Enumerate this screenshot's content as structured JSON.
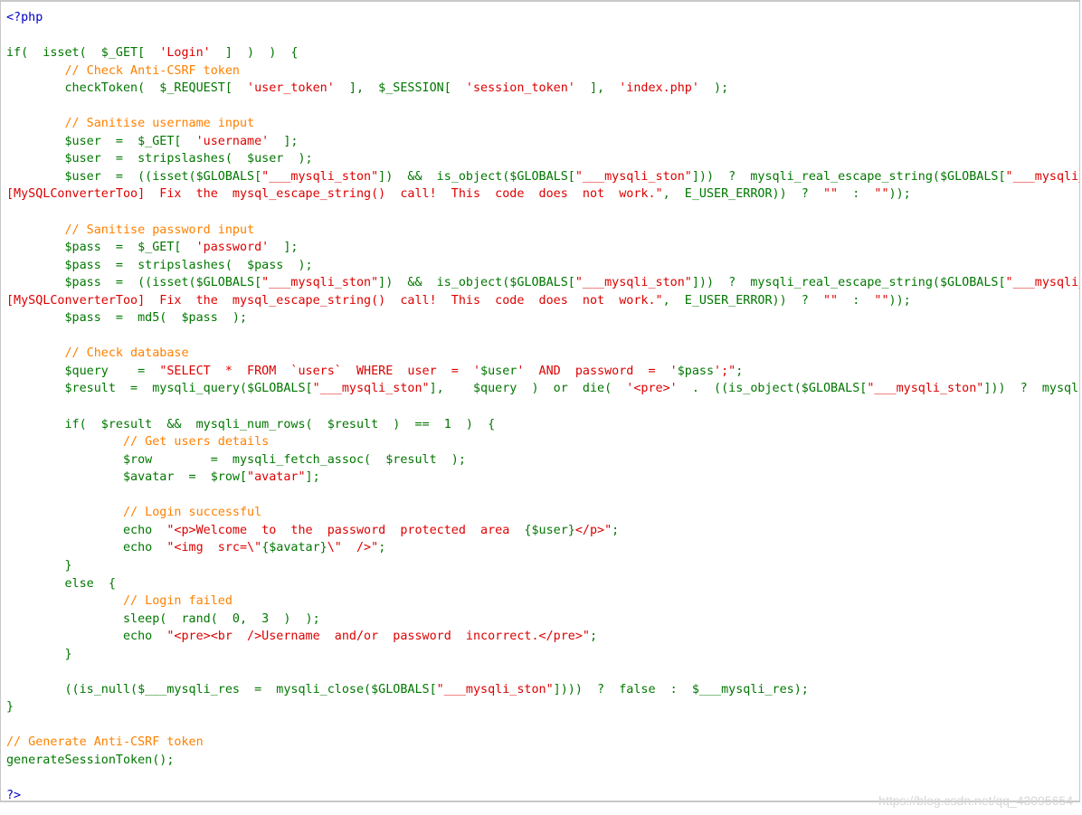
{
  "code_lines": [
    [
      {
        "t": "<?php",
        "c": "blue"
      }
    ],
    [],
    [
      {
        "t": "if(  isset(  $_GET[  ",
        "c": "green"
      },
      {
        "t": "'Login'",
        "c": "red"
      },
      {
        "t": "  ]  )  )  {",
        "c": "green"
      }
    ],
    [
      {
        "t": "        // Check Anti-CSRF token",
        "c": "orange"
      }
    ],
    [
      {
        "t": "        checkToken(  $_REQUEST[  ",
        "c": "green"
      },
      {
        "t": "'user_token'",
        "c": "red"
      },
      {
        "t": "  ],  $_SESSION[  ",
        "c": "green"
      },
      {
        "t": "'session_token'",
        "c": "red"
      },
      {
        "t": "  ],  ",
        "c": "green"
      },
      {
        "t": "'index.php'",
        "c": "red"
      },
      {
        "t": "  );",
        "c": "green"
      }
    ],
    [],
    [
      {
        "t": "        // Sanitise username input",
        "c": "orange"
      }
    ],
    [
      {
        "t": "        $user  =  $_GET[  ",
        "c": "green"
      },
      {
        "t": "'username'",
        "c": "red"
      },
      {
        "t": "  ];",
        "c": "green"
      }
    ],
    [
      {
        "t": "        $user  =  stripslashes(  $user  );",
        "c": "green"
      }
    ],
    [
      {
        "t": "        $user  =  ((isset($GLOBALS[",
        "c": "green"
      },
      {
        "t": "\"___mysqli_ston\"",
        "c": "red"
      },
      {
        "t": "])  &&  is_object($GLOBALS[",
        "c": "green"
      },
      {
        "t": "\"___mysqli_ston\"",
        "c": "red"
      },
      {
        "t": "]))  ?  mysqli_real_escape_string($GLOBALS[",
        "c": "green"
      },
      {
        "t": "\"___mysqli_s",
        "c": "red"
      }
    ],
    [
      {
        "t": "[MySQLConverterToo]  Fix  the  mysql_escape_string()  call!  This  code  does  not  work.\"",
        "c": "red"
      },
      {
        "t": ",  E_USER_ERROR))  ?  ",
        "c": "green"
      },
      {
        "t": "\"\"",
        "c": "red"
      },
      {
        "t": "  :  ",
        "c": "green"
      },
      {
        "t": "\"\"",
        "c": "red"
      },
      {
        "t": "));",
        "c": "green"
      }
    ],
    [],
    [
      {
        "t": "        // Sanitise password input",
        "c": "orange"
      }
    ],
    [
      {
        "t": "        $pass  =  $_GET[  ",
        "c": "green"
      },
      {
        "t": "'password'",
        "c": "red"
      },
      {
        "t": "  ];",
        "c": "green"
      }
    ],
    [
      {
        "t": "        $pass  =  stripslashes(  $pass  );",
        "c": "green"
      }
    ],
    [
      {
        "t": "        $pass  =  ((isset($GLOBALS[",
        "c": "green"
      },
      {
        "t": "\"___mysqli_ston\"",
        "c": "red"
      },
      {
        "t": "])  &&  is_object($GLOBALS[",
        "c": "green"
      },
      {
        "t": "\"___mysqli_ston\"",
        "c": "red"
      },
      {
        "t": "]))  ?  mysqli_real_escape_string($GLOBALS[",
        "c": "green"
      },
      {
        "t": "\"___mysqli_s",
        "c": "red"
      }
    ],
    [
      {
        "t": "[MySQLConverterToo]  Fix  the  mysql_escape_string()  call!  This  code  does  not  work.\"",
        "c": "red"
      },
      {
        "t": ",  E_USER_ERROR))  ?  ",
        "c": "green"
      },
      {
        "t": "\"\"",
        "c": "red"
      },
      {
        "t": "  :  ",
        "c": "green"
      },
      {
        "t": "\"\"",
        "c": "red"
      },
      {
        "t": "));",
        "c": "green"
      }
    ],
    [
      {
        "t": "        $pass  =  md5(  $pass  );",
        "c": "green"
      }
    ],
    [],
    [
      {
        "t": "        // Check database",
        "c": "orange"
      }
    ],
    [
      {
        "t": "        $query    =  ",
        "c": "green"
      },
      {
        "t": "\"SELECT  *  FROM  `users`  WHERE  user  =  '",
        "c": "red"
      },
      {
        "t": "$user",
        "c": "green"
      },
      {
        "t": "'  AND  password  =  '",
        "c": "red"
      },
      {
        "t": "$pass",
        "c": "green"
      },
      {
        "t": "';\"",
        "c": "red"
      },
      {
        "t": ";",
        "c": "green"
      }
    ],
    [
      {
        "t": "        $result  =  mysqli_query($GLOBALS[",
        "c": "green"
      },
      {
        "t": "\"___mysqli_ston\"",
        "c": "red"
      },
      {
        "t": "],    $query  )  or  die(  ",
        "c": "green"
      },
      {
        "t": "'<pre>'",
        "c": "red"
      },
      {
        "t": "  .  ((is_object($GLOBALS[",
        "c": "green"
      },
      {
        "t": "\"___mysqli_ston\"",
        "c": "red"
      },
      {
        "t": "]))  ?  mysqli_",
        "c": "green"
      }
    ],
    [],
    [
      {
        "t": "        if(  $result  &&  mysqli_num_rows(  $result  )  ==  1  )  {",
        "c": "green"
      }
    ],
    [
      {
        "t": "                // Get users details",
        "c": "orange"
      }
    ],
    [
      {
        "t": "                $row        =  mysqli_fetch_assoc(  $result  );",
        "c": "green"
      }
    ],
    [
      {
        "t": "                $avatar  =  $row[",
        "c": "green"
      },
      {
        "t": "\"avatar\"",
        "c": "red"
      },
      {
        "t": "];",
        "c": "green"
      }
    ],
    [],
    [
      {
        "t": "                // Login successful",
        "c": "orange"
      }
    ],
    [
      {
        "t": "                echo  ",
        "c": "green"
      },
      {
        "t": "\"<p>Welcome  to  the  password  protected  area  ",
        "c": "red"
      },
      {
        "t": "{$user}",
        "c": "green"
      },
      {
        "t": "</p>\"",
        "c": "red"
      },
      {
        "t": ";",
        "c": "green"
      }
    ],
    [
      {
        "t": "                echo  ",
        "c": "green"
      },
      {
        "t": "\"<img  src=\\\"",
        "c": "red"
      },
      {
        "t": "{$avatar}",
        "c": "green"
      },
      {
        "t": "\\\"  />\"",
        "c": "red"
      },
      {
        "t": ";",
        "c": "green"
      }
    ],
    [
      {
        "t": "        }",
        "c": "green"
      }
    ],
    [
      {
        "t": "        else  {",
        "c": "green"
      }
    ],
    [
      {
        "t": "                // Login failed",
        "c": "orange"
      }
    ],
    [
      {
        "t": "                sleep(  rand(  0,  3  )  );",
        "c": "green"
      }
    ],
    [
      {
        "t": "                echo  ",
        "c": "green"
      },
      {
        "t": "\"<pre><br  />Username  and/or  password  incorrect.</pre>\"",
        "c": "red"
      },
      {
        "t": ";",
        "c": "green"
      }
    ],
    [
      {
        "t": "        }",
        "c": "green"
      }
    ],
    [],
    [
      {
        "t": "        ((is_null($___mysqli_res  =  mysqli_close($GLOBALS[",
        "c": "green"
      },
      {
        "t": "\"___mysqli_ston\"",
        "c": "red"
      },
      {
        "t": "])))  ?  false  :  $___mysqli_res);",
        "c": "green"
      }
    ],
    [
      {
        "t": "}",
        "c": "green"
      }
    ],
    [],
    [
      {
        "t": "// Generate Anti-CSRF token",
        "c": "orange"
      }
    ],
    [
      {
        "t": "generateSessionToken();",
        "c": "green"
      }
    ],
    [],
    [
      {
        "t": "?>",
        "c": "blue"
      }
    ]
  ],
  "watermark": "https://blog.csdn.net/qq_43095654"
}
